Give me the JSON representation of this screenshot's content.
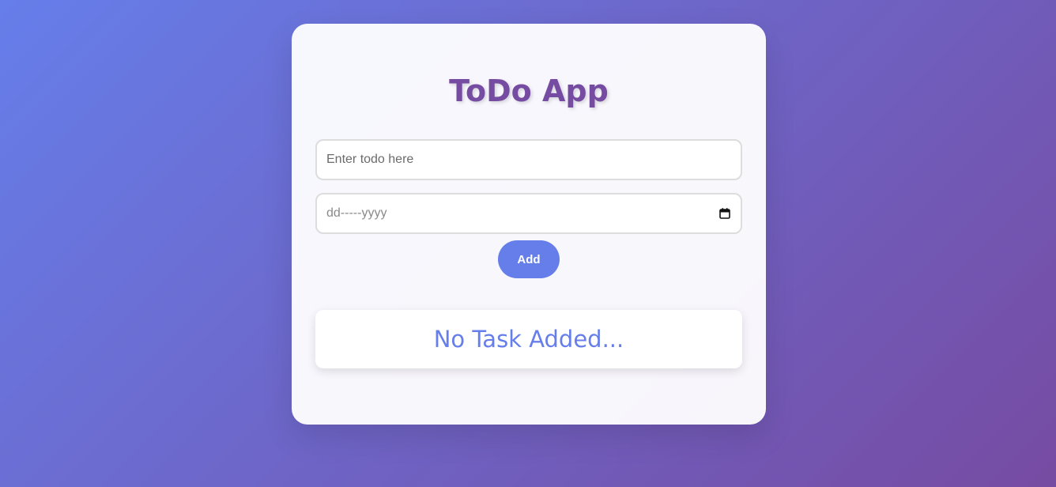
{
  "app": {
    "title": "ToDo App"
  },
  "form": {
    "todo_placeholder": "Enter todo here",
    "todo_value": "",
    "date_placeholder": "dd-----yyyy",
    "add_label": "Add"
  },
  "list": {
    "empty_message": "No Task Added..."
  },
  "icons": {
    "date_picker": "calendar-icon"
  },
  "colors": {
    "gradient_start": "#667eea",
    "gradient_end": "#764ba2",
    "title": "#764ba2",
    "accent": "#667eea"
  }
}
